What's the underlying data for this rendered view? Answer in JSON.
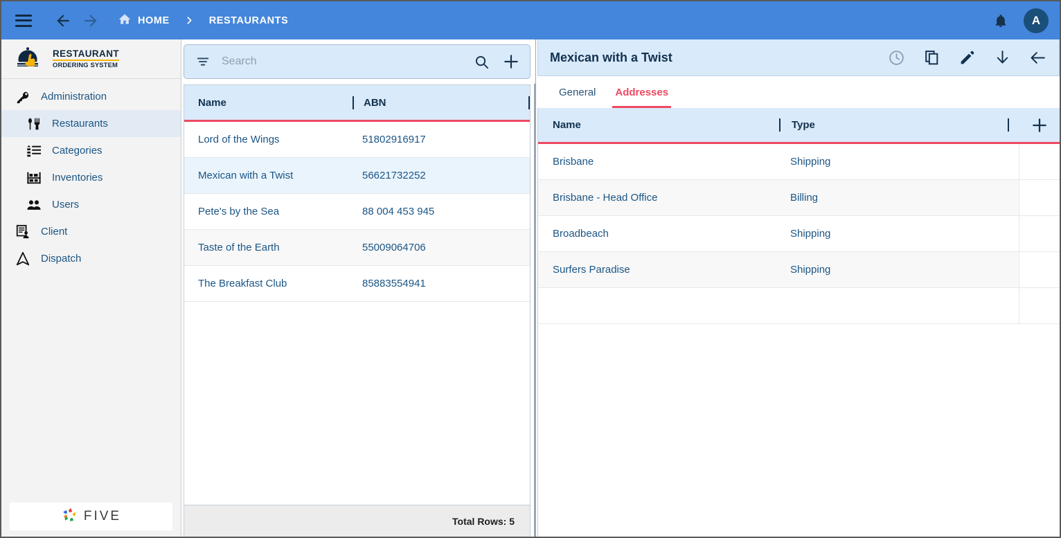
{
  "topbar": {
    "menu_icon": "hamburger-icon",
    "back_icon": "arrow-back-icon",
    "forward_icon": "arrow-forward-icon",
    "home_icon": "home-icon",
    "home_label": "HOME",
    "separator": "chevron-right-icon",
    "current_label": "RESTAURANTS",
    "notifications_icon": "bell-icon",
    "avatar_initial": "A",
    "bg_color": "#4486db",
    "avatar_color": "#1a4f7a"
  },
  "sidebar": {
    "brand": {
      "icon": "cloche-hand-logo",
      "line1": "RESTAURANT",
      "line2": "ORDERING SYSTEM",
      "accent_color": "#f5b50a"
    },
    "items": [
      {
        "label": "Administration",
        "icon": "key-icon",
        "level": 0,
        "active": false
      },
      {
        "label": "Restaurants",
        "icon": "fork-spoon-icon",
        "level": 1,
        "active": true
      },
      {
        "label": "Categories",
        "icon": "list-icon",
        "level": 1,
        "active": false
      },
      {
        "label": "Inventories",
        "icon": "shelf-icon",
        "level": 1,
        "active": false
      },
      {
        "label": "Users",
        "icon": "people-icon",
        "level": 1,
        "active": false
      },
      {
        "label": "Client",
        "icon": "client-card-icon",
        "level": 0,
        "active": false
      },
      {
        "label": "Dispatch",
        "icon": "dispatch-arrow-icon",
        "level": 0,
        "active": false
      }
    ],
    "footer": {
      "logo_icon": "five-pinwheel-logo",
      "logo_text": "FIVE"
    }
  },
  "list_panel": {
    "search": {
      "filter_icon": "filter-icon",
      "placeholder": "Search",
      "value": "",
      "search_icon": "search-icon",
      "add_icon": "plus-icon"
    },
    "columns": [
      "Name",
      "ABN"
    ],
    "rows": [
      {
        "name": "Lord of the Wings",
        "abn": "51802916917",
        "selected": false
      },
      {
        "name": "Mexican with a Twist",
        "abn": "56621732252",
        "selected": true
      },
      {
        "name": "Pete's by the Sea",
        "abn": "88 004 453 945",
        "selected": false
      },
      {
        "name": "Taste of the Earth",
        "abn": "55009064706",
        "selected": false
      },
      {
        "name": "The Breakfast Club",
        "abn": "85883554941",
        "selected": false
      }
    ],
    "footer_text": "Total Rows: 5",
    "accent_underline": "#ee4a62",
    "header_bg": "#d9eafb"
  },
  "detail_panel": {
    "title": "Mexican with a Twist",
    "actions": [
      {
        "icon": "history-clock-icon",
        "disabled": true
      },
      {
        "icon": "copy-icon",
        "disabled": false
      },
      {
        "icon": "edit-pencil-icon",
        "disabled": false
      },
      {
        "icon": "download-arrow-icon",
        "disabled": false
      },
      {
        "icon": "arrow-back-icon",
        "disabled": false
      }
    ],
    "tabs": [
      {
        "label": "General",
        "active": false
      },
      {
        "label": "Addresses",
        "active": true
      }
    ],
    "addresses": {
      "columns": [
        "Name",
        "Type"
      ],
      "add_icon": "plus-icon",
      "rows": [
        {
          "name": "Brisbane",
          "type": "Shipping"
        },
        {
          "name": "Brisbane - Head Office",
          "type": "Billing"
        },
        {
          "name": "Broadbeach",
          "type": "Shipping"
        },
        {
          "name": "Surfers Paradise",
          "type": "Shipping"
        }
      ]
    },
    "active_tab_color": "#ee4a62"
  }
}
